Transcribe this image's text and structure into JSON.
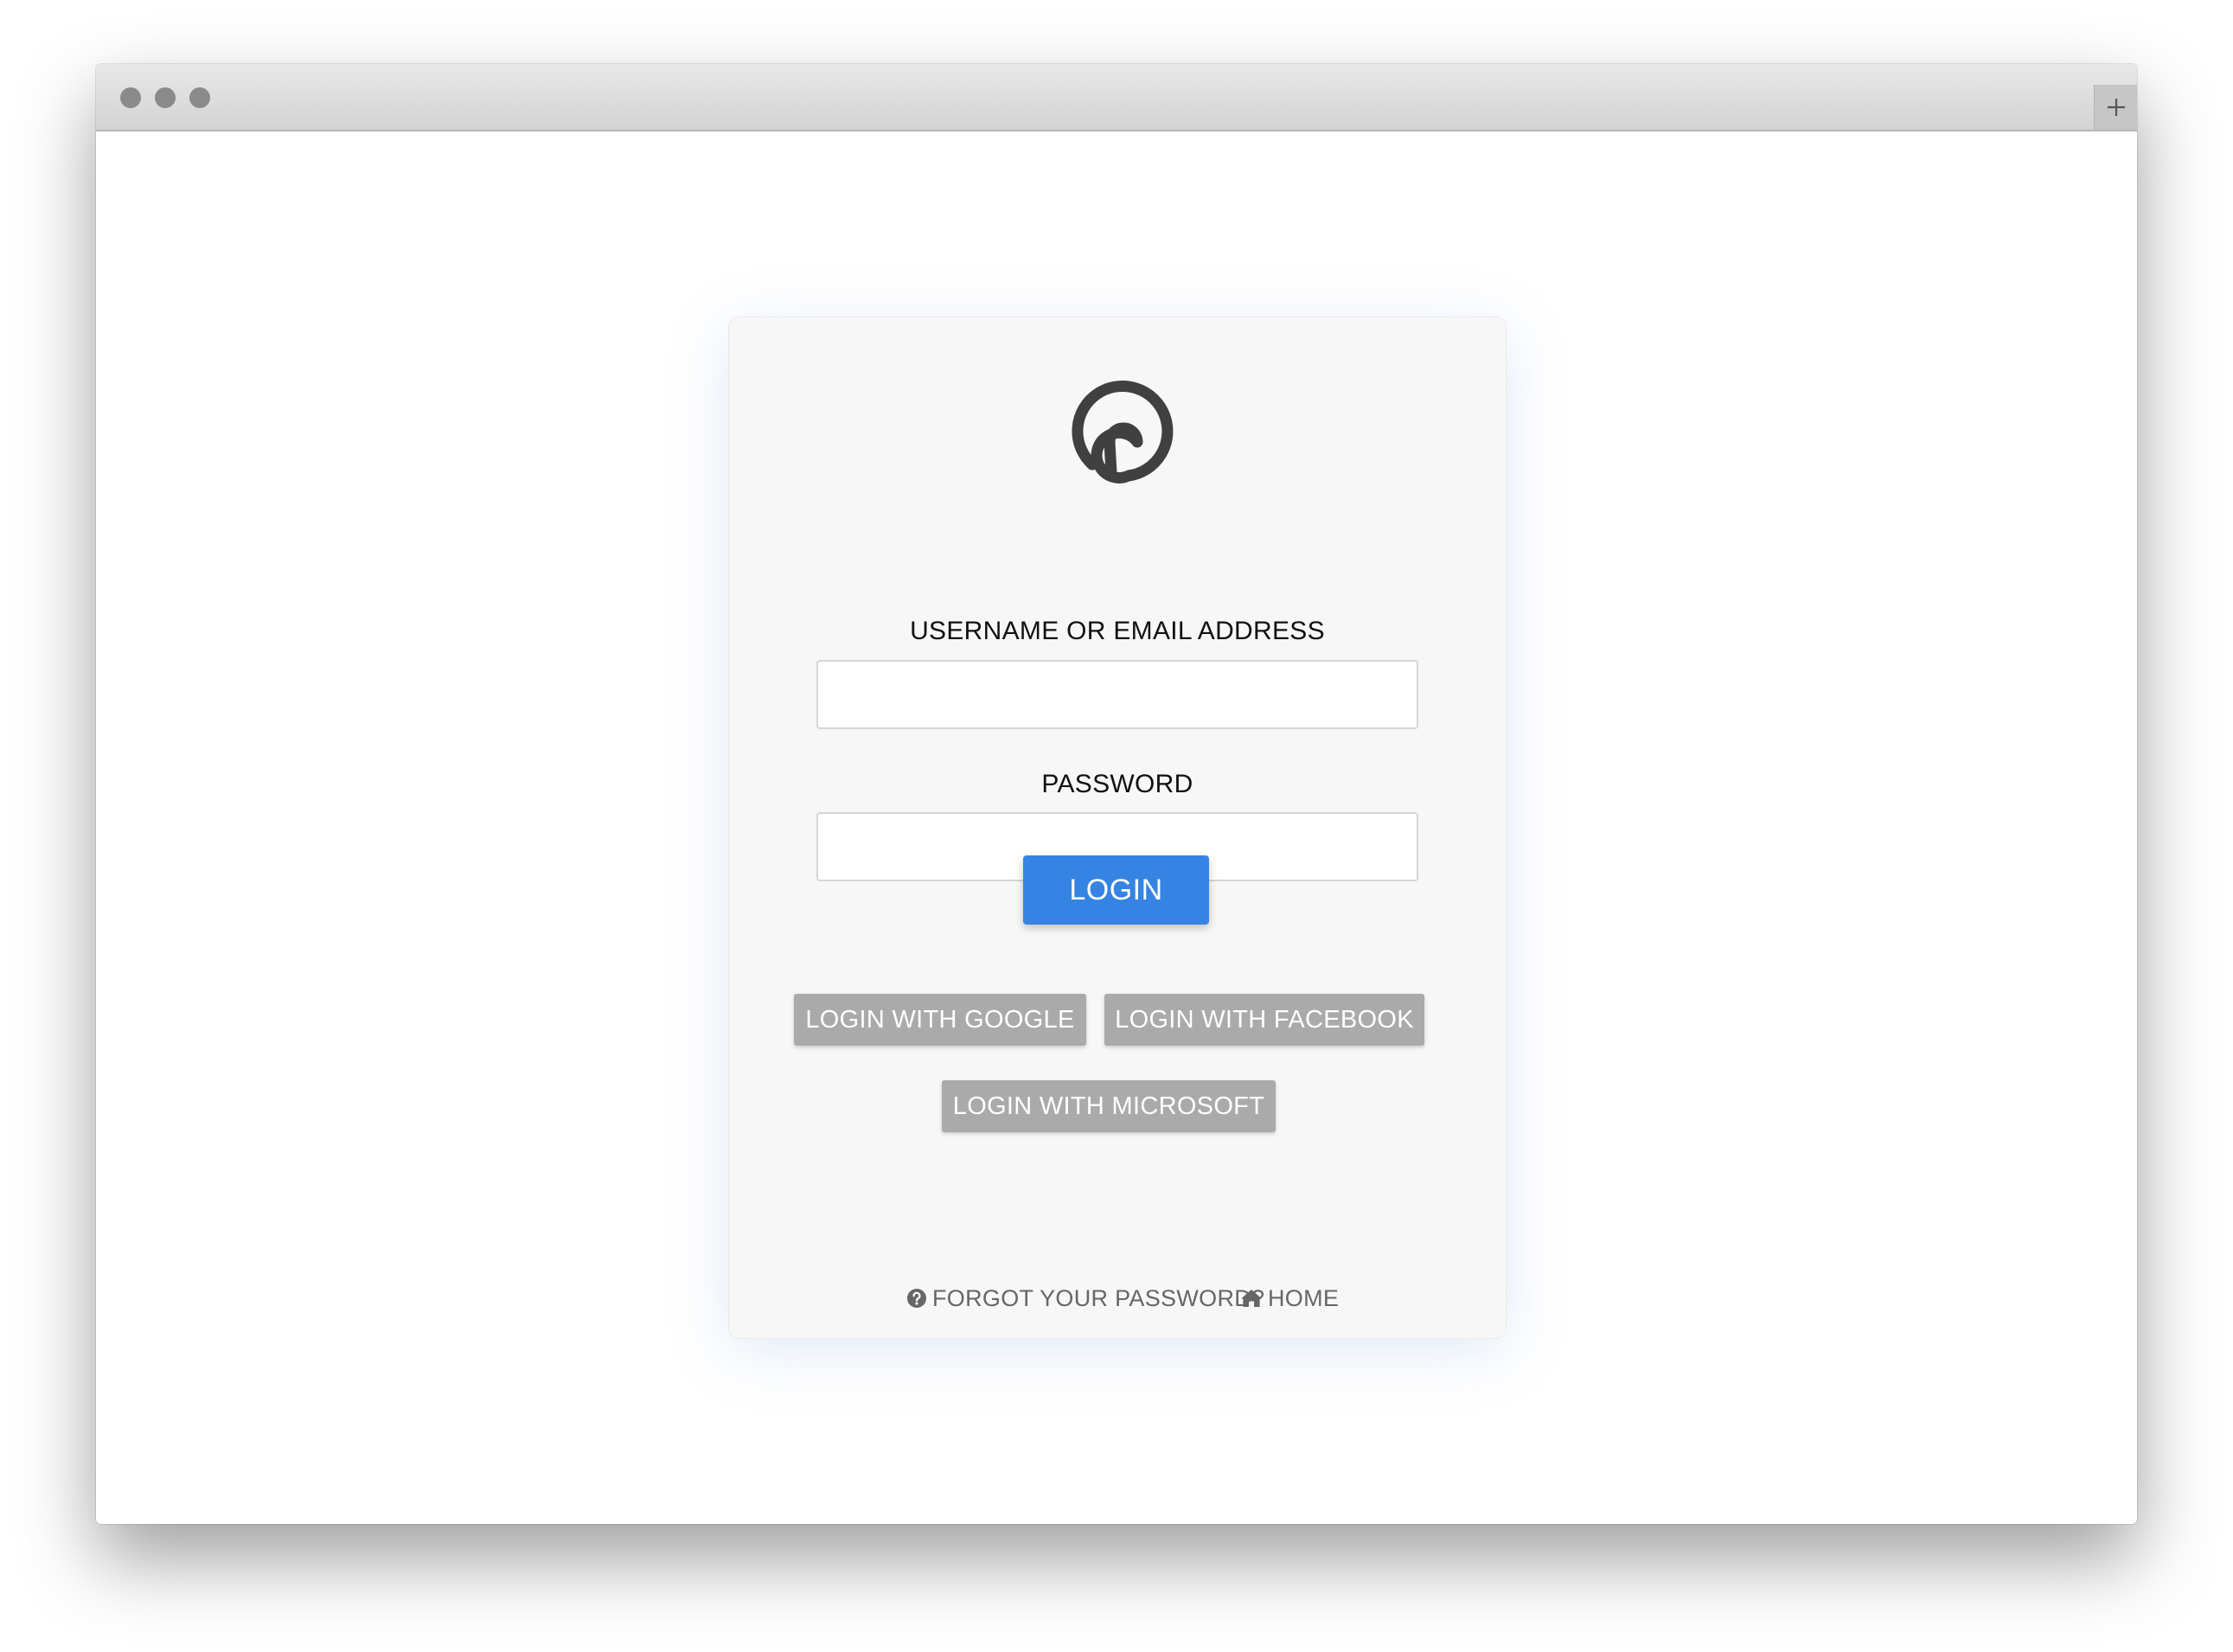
{
  "window": {
    "traffic_lights": [
      "close",
      "minimize",
      "zoom"
    ],
    "new_tab_icon": "plus-icon"
  },
  "login_form": {
    "logo_icon": "spiral-p-logo",
    "username_label": "USERNAME OR EMAIL ADDRESS",
    "username_value": "",
    "password_label": "PASSWORD",
    "password_value": "",
    "login_button": "LOGIN",
    "google_button": "LOGIN WITH GOOGLE",
    "facebook_button": "LOGIN WITH FACEBOOK",
    "microsoft_button": "LOGIN WITH MICROSOFT",
    "forgot_link": "FORGOT YOUR PASSWORD?",
    "forgot_icon": "question-circle-icon",
    "home_link": "HOME",
    "home_icon": "home-icon"
  },
  "colors": {
    "primary_button": "#3584e4",
    "social_button": "#aaaaaa",
    "card_background": "#f7f7f7"
  }
}
